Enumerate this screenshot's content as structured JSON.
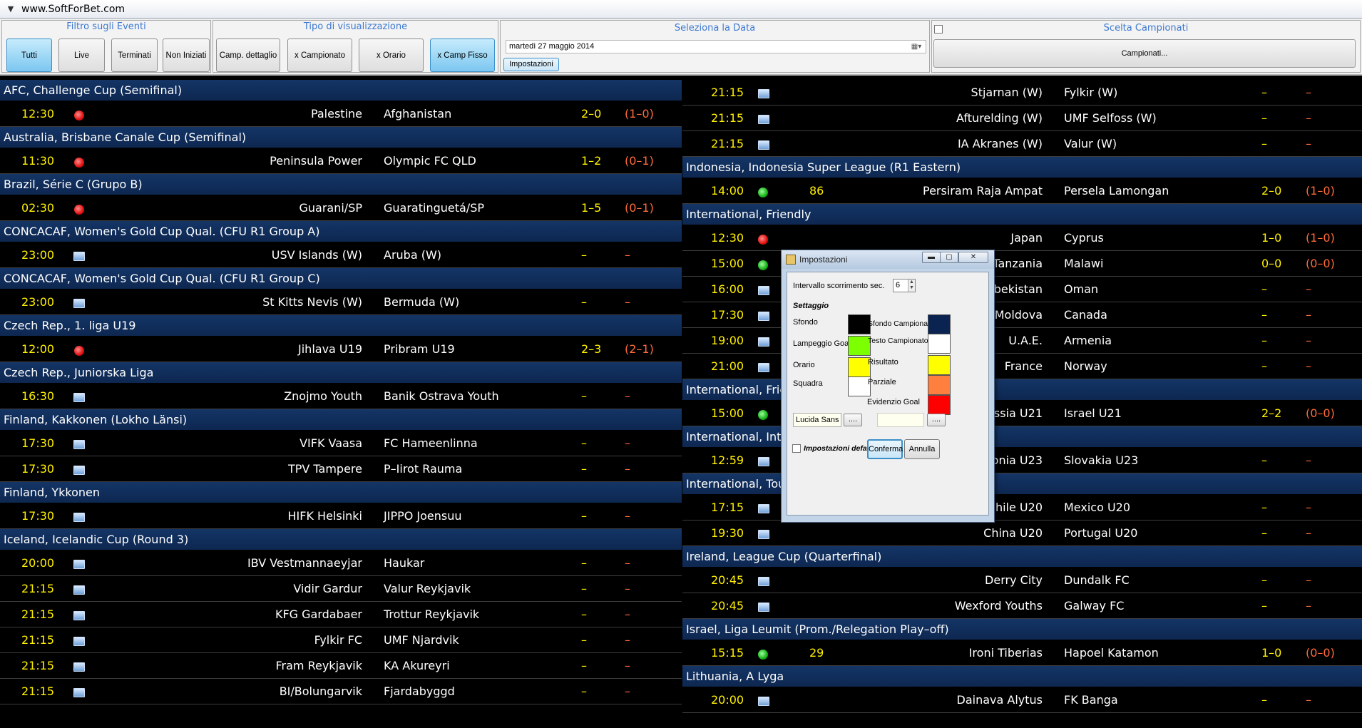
{
  "window": {
    "title": "www.SoftForBet.com"
  },
  "toolbar": {
    "filter_title": "Filtro sugli Eventi",
    "filters": [
      "Tutti",
      "Live",
      "Terminati",
      "Non Iniziati"
    ],
    "view_title": "Tipo di visualizzazione",
    "views": [
      "Camp. dettaglio",
      "x Campionato",
      "x Orario",
      "x Camp Fisso"
    ],
    "date_title": "Seleziona la Data",
    "date_value": "martedì  27  maggio  2014",
    "settings_button": "Impostazioni",
    "champ_title": "Scelta Campionati",
    "champ_button": "Campionati..."
  },
  "left": [
    {
      "league": "AFC, Challenge Cup (Semifinal)",
      "matches": [
        {
          "time": "12:30",
          "icon": "live-red-icon",
          "minute": "",
          "home": "Palestine",
          "away": "Afghanistan",
          "score": "2–0",
          "half": "(1–0)"
        }
      ]
    },
    {
      "league": "Australia, Brisbane Canale Cup (Semifinal)",
      "matches": [
        {
          "time": "11:30",
          "icon": "live-red-icon",
          "minute": "",
          "home": "Peninsula Power",
          "away": "Olympic FC QLD",
          "score": "1–2",
          "half": "(0–1)"
        }
      ]
    },
    {
      "league": "Brazil, Série C (Grupo B)",
      "matches": [
        {
          "time": "02:30",
          "icon": "live-red-icon",
          "minute": "",
          "home": "Guarani/SP",
          "away": "Guaratinguetá/SP",
          "score": "1–5",
          "half": "(0–1)"
        }
      ]
    },
    {
      "league": "CONCACAF, Women's Gold Cup Qual. (CFU R1 Group A)",
      "matches": [
        {
          "time": "23:00",
          "icon": "tv-icon",
          "minute": "",
          "home": "USV Islands (W)",
          "away": "Aruba (W)",
          "score": "–",
          "half": "–"
        }
      ]
    },
    {
      "league": "CONCACAF, Women's Gold Cup Qual. (CFU R1 Group C)",
      "matches": [
        {
          "time": "23:00",
          "icon": "tv-icon",
          "minute": "",
          "home": "St Kitts  Nevis (W)",
          "away": "Bermuda (W)",
          "score": "–",
          "half": "–"
        }
      ]
    },
    {
      "league": "Czech Rep., 1. liga U19",
      "matches": [
        {
          "time": "12:00",
          "icon": "live-red-icon",
          "minute": "",
          "home": "Jihlava U19",
          "away": "Pribram U19",
          "score": "2–3",
          "half": "(2–1)"
        }
      ]
    },
    {
      "league": "Czech Rep., Juniorska Liga",
      "matches": [
        {
          "time": "16:30",
          "icon": "tv-icon",
          "minute": "",
          "home": "Znojmo Youth",
          "away": "Banik Ostrava Youth",
          "score": "–",
          "half": "–"
        }
      ]
    },
    {
      "league": "Finland, Kakkonen (Lokho Länsi)",
      "matches": [
        {
          "time": "17:30",
          "icon": "tv-icon",
          "minute": "",
          "home": "VIFK Vaasa",
          "away": "FC Hameenlinna",
          "score": "–",
          "half": "–"
        },
        {
          "time": "17:30",
          "icon": "tv-icon",
          "minute": "",
          "home": "TPV Tampere",
          "away": "P–Iirot Rauma",
          "score": "–",
          "half": "–"
        }
      ]
    },
    {
      "league": "Finland, Ykkonen",
      "matches": [
        {
          "time": "17:30",
          "icon": "tv-icon",
          "minute": "",
          "home": "HIFK Helsinki",
          "away": "JIPPO Joensuu",
          "score": "–",
          "half": "–"
        }
      ]
    },
    {
      "league": "Iceland, Icelandic Cup (Round 3)",
      "matches": [
        {
          "time": "20:00",
          "icon": "tv-icon",
          "minute": "",
          "home": "IBV Vestmannaeyjar",
          "away": "Haukar",
          "score": "–",
          "half": "–"
        },
        {
          "time": "21:15",
          "icon": "tv-icon",
          "minute": "",
          "home": "Vidir Gardur",
          "away": "Valur Reykjavik",
          "score": "–",
          "half": "–"
        },
        {
          "time": "21:15",
          "icon": "tv-icon",
          "minute": "",
          "home": "KFG Gardabaer",
          "away": "Trottur Reykjavik",
          "score": "–",
          "half": "–"
        },
        {
          "time": "21:15",
          "icon": "tv-icon",
          "minute": "",
          "home": "Fylkir FC",
          "away": "UMF Njardvik",
          "score": "–",
          "half": "–"
        },
        {
          "time": "21:15",
          "icon": "tv-icon",
          "minute": "",
          "home": "Fram Reykjavik",
          "away": "KA Akureyri",
          "score": "–",
          "half": "–"
        },
        {
          "time": "21:15",
          "icon": "tv-icon",
          "minute": "",
          "home": "BI/Bolungarvik",
          "away": "Fjardabyggd",
          "score": "–",
          "half": "–"
        }
      ]
    }
  ],
  "right": [
    {
      "league": "",
      "matches": [
        {
          "time": "21:15",
          "icon": "tv-icon",
          "minute": "",
          "home": "Stjarnan (W)",
          "away": "Fylkir (W)",
          "score": "–",
          "half": "–"
        },
        {
          "time": "21:15",
          "icon": "tv-icon",
          "minute": "",
          "home": "Afturelding (W)",
          "away": "UMF Selfoss (W)",
          "score": "–",
          "half": "–"
        },
        {
          "time": "21:15",
          "icon": "tv-icon",
          "minute": "",
          "home": "IA Akranes (W)",
          "away": "Valur (W)",
          "score": "–",
          "half": "–"
        }
      ]
    },
    {
      "league": "Indonesia, Indonesia Super League (R1 Eastern)",
      "matches": [
        {
          "time": "14:00",
          "icon": "live-green-icon",
          "minute": "86",
          "home": "Persiram Raja Ampat",
          "away": "Persela Lamongan",
          "score": "2–0",
          "half": "(1–0)"
        }
      ]
    },
    {
      "league": "International, Friendly",
      "matches": [
        {
          "time": "12:30",
          "icon": "live-red-icon",
          "minute": "",
          "home": "Japan",
          "away": "Cyprus",
          "score": "1–0",
          "half": "(1–0)"
        },
        {
          "time": "15:00",
          "icon": "live-green-icon",
          "minute": "",
          "home": "Tanzania",
          "away": "Malawi",
          "score": "0–0",
          "half": "(0–0)"
        },
        {
          "time": "16:00",
          "icon": "tv-icon",
          "minute": "",
          "home": "Uzbekistan",
          "away": "Oman",
          "score": "–",
          "half": "–"
        },
        {
          "time": "17:30",
          "icon": "tv-icon",
          "minute": "",
          "home": "Moldova",
          "away": "Canada",
          "score": "–",
          "half": "–"
        },
        {
          "time": "19:00",
          "icon": "tv-icon",
          "minute": "",
          "home": "U.A.E.",
          "away": "Armenia",
          "score": "–",
          "half": "–"
        },
        {
          "time": "21:00",
          "icon": "tv-icon",
          "minute": "",
          "home": "France",
          "away": "Norway",
          "score": "–",
          "half": "–"
        }
      ]
    },
    {
      "league": "International, Frie",
      "matches": [
        {
          "time": "15:00",
          "icon": "live-green-icon",
          "minute": "",
          "home": "ssia U21",
          "away": "Israel U21",
          "score": "2–2",
          "half": "(0–0)"
        }
      ]
    },
    {
      "league": "International, Inte",
      "matches": [
        {
          "time": "12:59",
          "icon": "tv-icon",
          "minute": "",
          "home": "onia U23",
          "away": "Slovakia U23",
          "score": "–",
          "half": "–"
        }
      ]
    },
    {
      "league": "International, Tou",
      "matches": [
        {
          "time": "17:15",
          "icon": "tv-icon",
          "minute": "",
          "home": "Chile U20",
          "away": "Mexico U20",
          "score": "–",
          "half": "–"
        },
        {
          "time": "19:30",
          "icon": "tv-icon",
          "minute": "",
          "home": "China U20",
          "away": "Portugal U20",
          "score": "–",
          "half": "–"
        }
      ]
    },
    {
      "league": "Ireland, League Cup (Quarterfinal)",
      "matches": [
        {
          "time": "20:45",
          "icon": "tv-icon",
          "minute": "",
          "home": "Derry City",
          "away": "Dundalk FC",
          "score": "–",
          "half": "–"
        },
        {
          "time": "20:45",
          "icon": "tv-icon",
          "minute": "",
          "home": "Wexford Youths",
          "away": "Galway FC",
          "score": "–",
          "half": "–"
        }
      ]
    },
    {
      "league": "Israel, Liga Leumit (Prom./Relegation Play–off)",
      "matches": [
        {
          "time": "15:15",
          "icon": "live-green-icon",
          "minute": "29",
          "home": "Ironi Tiberias",
          "away": "Hapoel Katamon",
          "score": "1–0",
          "half": "(0–0)"
        }
      ]
    },
    {
      "league": "Lithuania, A Lyga",
      "matches": [
        {
          "time": "20:00",
          "icon": "tv-icon",
          "minute": "",
          "home": "Dainava Alytus",
          "away": "FK Banga",
          "score": "–",
          "half": "–"
        }
      ]
    }
  ],
  "dialog": {
    "title": "Impostazioni",
    "interval_label": "Intervallo scorrimento sec.",
    "interval_value": "6",
    "section": "Settaggio",
    "labels": {
      "sfondo": "Sfondo",
      "lampeggio": "Lampeggio Goal",
      "orario": "Orario",
      "squadra": "Squadra",
      "sfondo_camp": "Sfondo Campionato",
      "testo_camp": "Testo Campionato",
      "risultato": "Risultato",
      "parziale": "Parziale",
      "evidenzio": "Evidenzio Goal"
    },
    "colors": {
      "sfondo": "#000000",
      "lampeggio": "#7cff00",
      "orario": "#ffff00",
      "squadra": "#ffffff",
      "sfondo_camp": "#0a2350",
      "testo_camp": "#ffffff",
      "risultato": "#ffff00",
      "parziale": "#ff7f3f",
      "evidenzio": "#ff0000"
    },
    "font_value": "Lucida Sans Un",
    "dots": "....",
    "default_label": "Impostazioni default",
    "ok": "Conferma",
    "cancel": "Annulla"
  }
}
